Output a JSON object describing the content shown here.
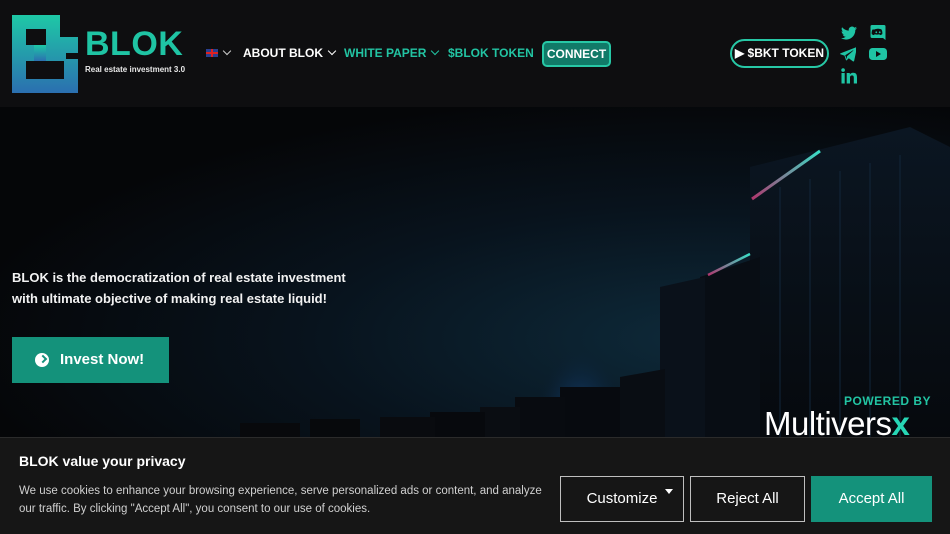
{
  "brand": {
    "name": "BLOK",
    "tagline": "Real estate investment 3.0",
    "accent": "#1fc4a4"
  },
  "nav": {
    "language_icon": "uk-flag-icon",
    "about": "ABOUT BLOK",
    "white_paper": "WHITE PAPER",
    "token": "$BLOK TOKEN",
    "connect": "CONNECT"
  },
  "header_right": {
    "bkt_button": "▶ $BKT TOKEN",
    "social_icons": [
      "twitter-icon",
      "discord-icon",
      "telegram-icon",
      "youtube-icon",
      "linkedin-icon"
    ]
  },
  "hero": {
    "headline": "BLOK is the democratization of real estate investment with ultimate objective of making real estate liquid!",
    "cta": "Invest Now!",
    "powered_by": "POWERED BY",
    "partner_name": "Multivers",
    "partner_suffix": "x"
  },
  "cookie_banner": {
    "title": "BLOK value your privacy",
    "text": "We use cookies to enhance your browsing experience, serve personalized ads or content, and analyze our traffic. By clicking \"Accept All\", you consent to our use of cookies.",
    "customize": "Customize",
    "reject": "Reject All",
    "accept": "Accept All"
  }
}
